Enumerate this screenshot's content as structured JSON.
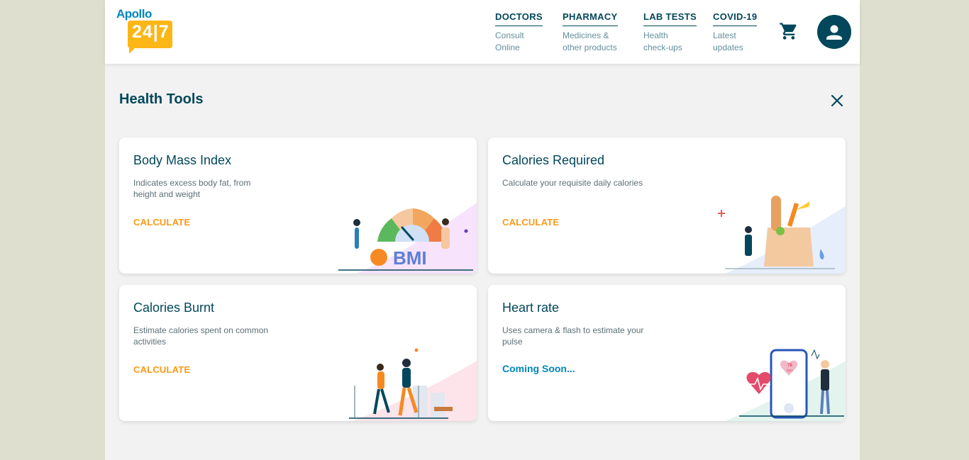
{
  "logo": {
    "word": "Apollo",
    "number": "24|7"
  },
  "nav": [
    {
      "title": "DOCTORS",
      "line1": "Consult",
      "line2": "Online"
    },
    {
      "title": "PHARMACY",
      "line1": "Medicines &",
      "line2": "other products"
    },
    {
      "title": "LAB TESTS",
      "line1": "Health",
      "line2": "check-ups"
    },
    {
      "title": "COVID-19",
      "line1": "Latest",
      "line2": "updates"
    }
  ],
  "page_title": "Health Tools",
  "cards": [
    {
      "title": "Body Mass Index",
      "desc": "Indicates excess body fat, from height and weight",
      "action": "CALCULATE",
      "badge": "BMI"
    },
    {
      "title": "Calories Required",
      "desc": "Calculate your requisite daily calories",
      "action": "CALCULATE"
    },
    {
      "title": "Calories Burnt",
      "desc": "Estimate calories spent on common activities",
      "action": "CALCULATE"
    },
    {
      "title": "Heart rate",
      "desc": "Uses camera & flash to estimate your pulse",
      "action": "Coming Soon...",
      "phone_reading": "78",
      "phone_unit": "bpm"
    }
  ],
  "colors": {
    "brand": "#02475b",
    "accent": "#fc9916",
    "link": "#0087ba",
    "logo_yellow": "#fcb716"
  },
  "icons": {
    "cart": "cart-icon",
    "profile": "user-icon",
    "close": "close-icon"
  }
}
